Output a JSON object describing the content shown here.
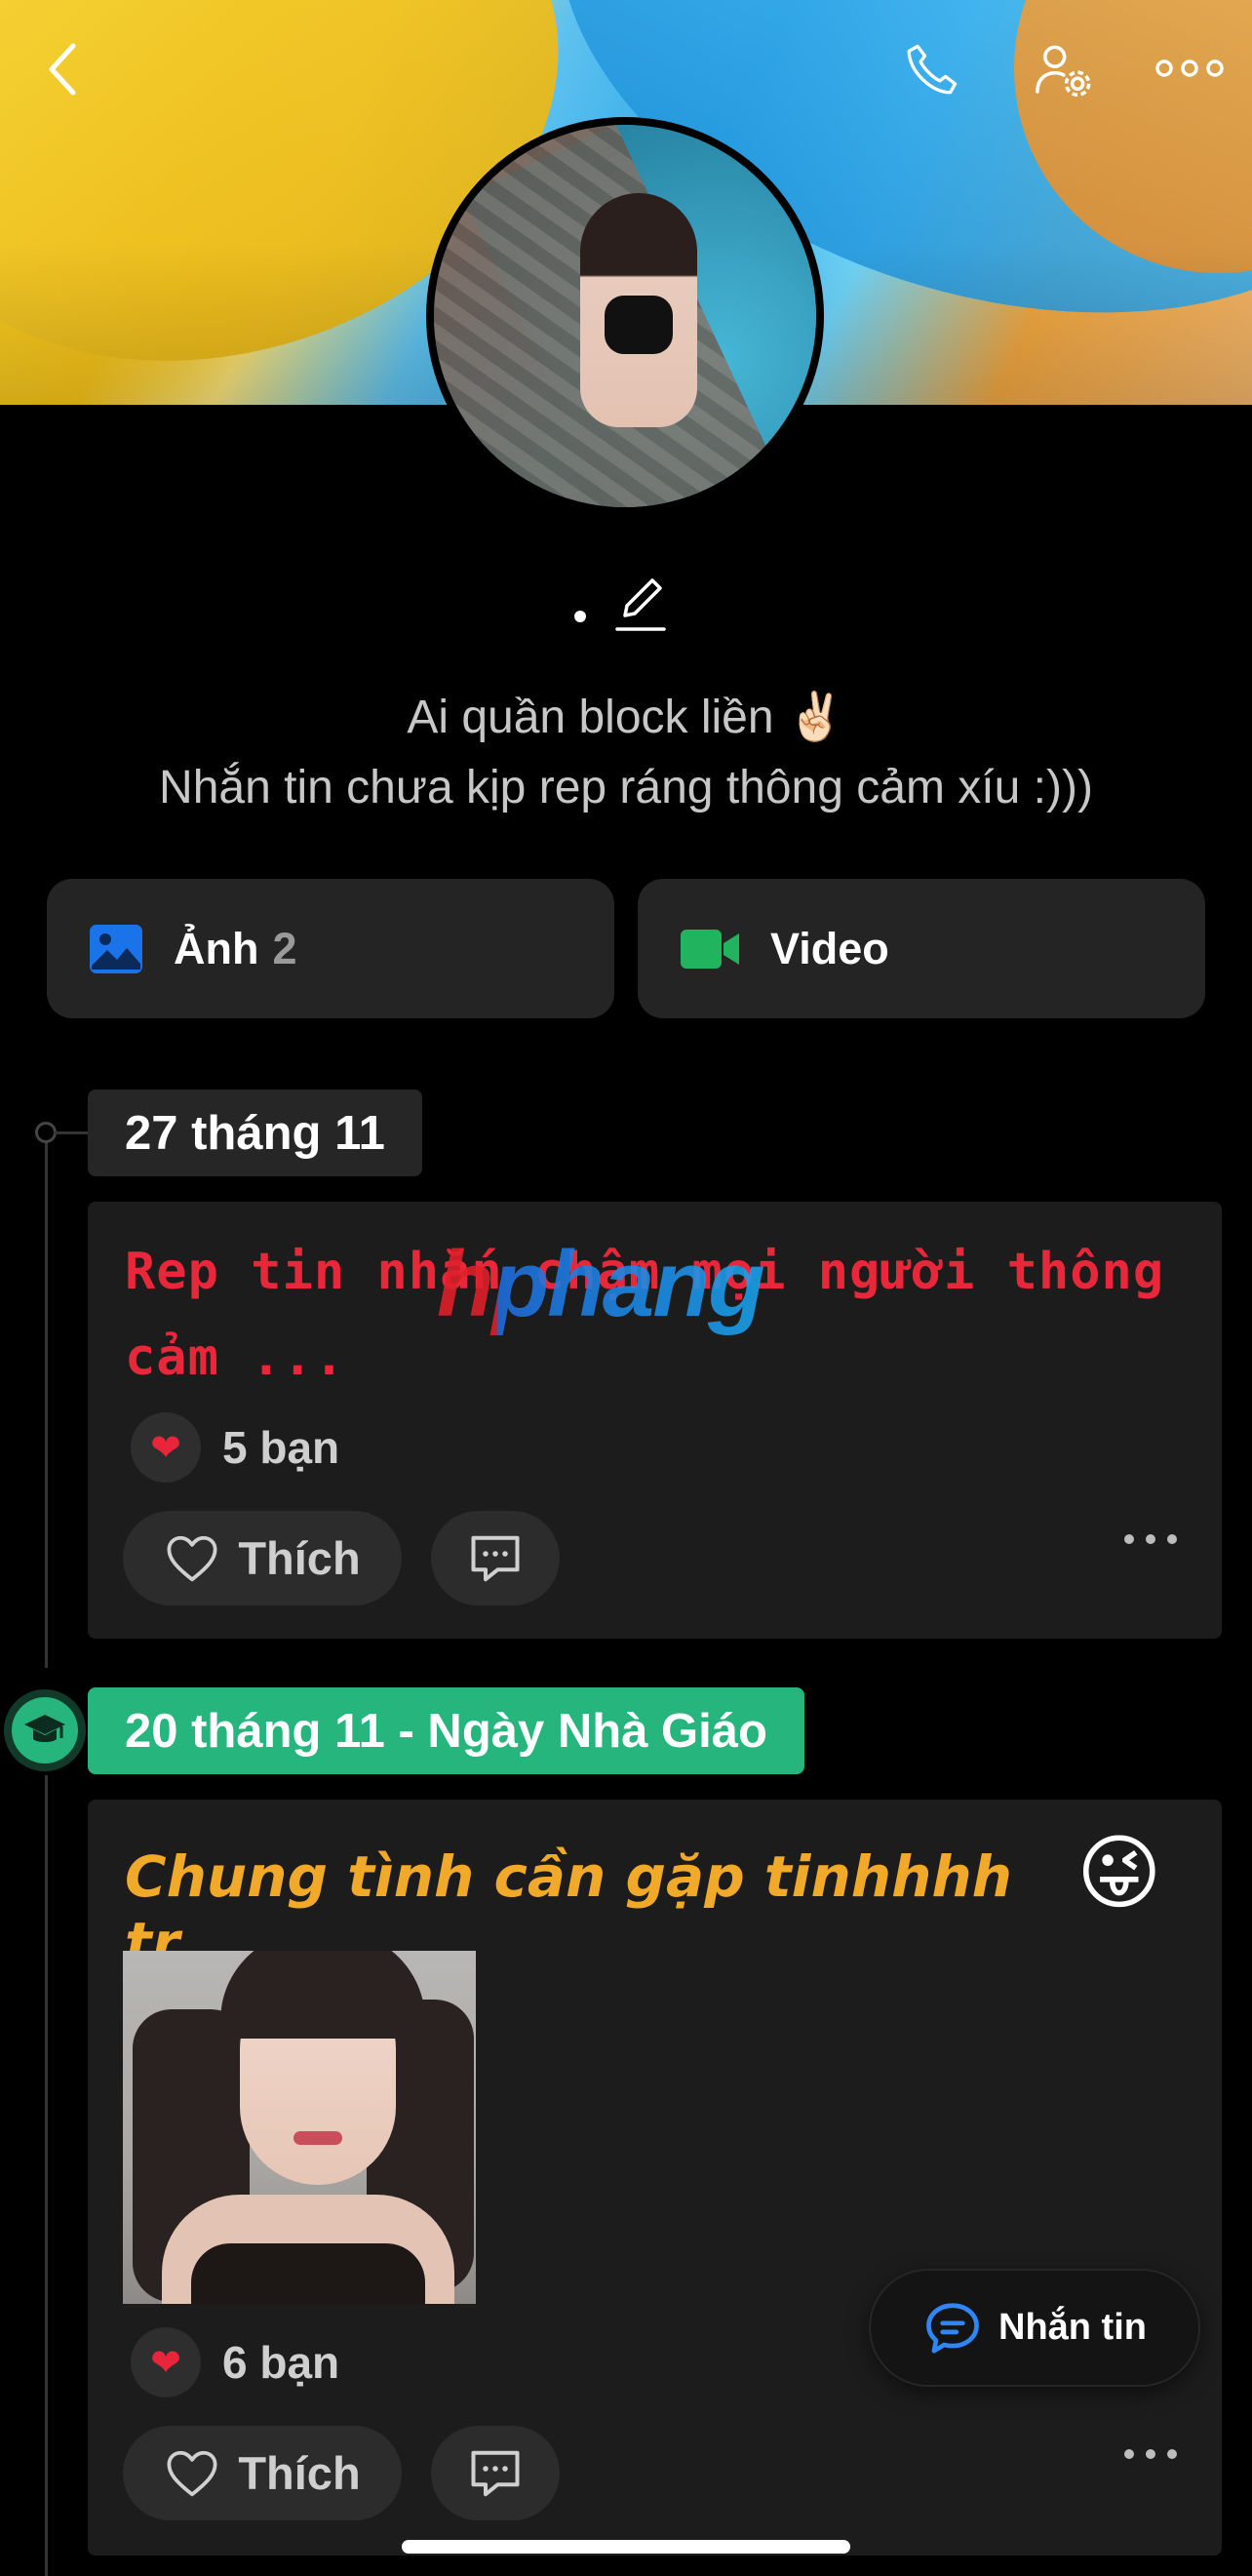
{
  "header": {
    "back_icon": "chevron-left-icon",
    "call_icon": "phone-icon",
    "settings_icon": "user-settings-icon",
    "more_icon": "more-horizontal-icon"
  },
  "profile": {
    "name": ".",
    "bio_line1": "Ai quần block liền ✌🏻",
    "bio_line2": "Nhắn tin chưa kịp rep ráng thông cảm xíu :)))"
  },
  "media": {
    "photos_label": "Ảnh",
    "photos_count": "2",
    "video_label": "Video",
    "photo_color": "#1a73e8",
    "video_color": "#22b35e"
  },
  "timeline": [
    {
      "date": "27 tháng 11",
      "text": "Rep tin nhắn chậm mọi người thông cảm ...",
      "likes": "5 bạn",
      "like_label": "Thích",
      "text_color": "#e8283a"
    },
    {
      "date": "20 tháng 11 - Ngày Nhà Giáo",
      "date_color": "#26b57d",
      "text": "Chung tình cần gặp tinhhhh tr.........",
      "emoji": "😜",
      "likes": "6 bạn",
      "like_label": "Thích",
      "text_color": "#f1a929"
    }
  ],
  "watermark": "hphang",
  "floating": {
    "message_label": "Nhắn tin"
  }
}
